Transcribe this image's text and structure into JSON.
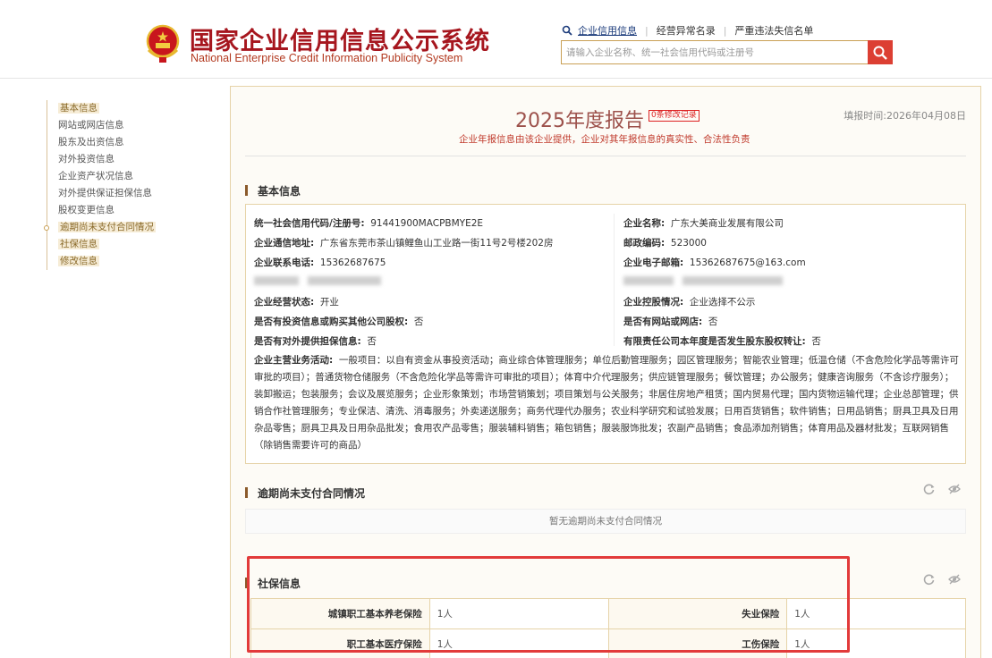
{
  "header": {
    "title_cn": "国家企业信用信息公示系统",
    "title_en": "National Enterprise Credit Information Publicity System",
    "nav": [
      "企业信用信息",
      "经营异常名录",
      "严重违法失信名单"
    ],
    "search_placeholder": "请输入企业名称、统一社会信用代码或注册号"
  },
  "sidenav": [
    {
      "label": "基本信息",
      "highlighted": true
    },
    {
      "label": "网站或网店信息",
      "highlighted": false
    },
    {
      "label": "股东及出资信息",
      "highlighted": false
    },
    {
      "label": "对外投资信息",
      "highlighted": false
    },
    {
      "label": "企业资产状况信息",
      "highlighted": false
    },
    {
      "label": "对外提供保证担保信息",
      "highlighted": false
    },
    {
      "label": "股权变更信息",
      "highlighted": false
    },
    {
      "label": "逾期尚未支付合同情况",
      "highlighted": true
    },
    {
      "label": "社保信息",
      "highlighted": true
    },
    {
      "label": "修改信息",
      "highlighted": true
    }
  ],
  "report": {
    "title": "2025年度报告",
    "badge": "0条修改记录",
    "fill_time": "填报时间:2026年04月08日",
    "notice": "企业年报信息由该企业提供，企业对其年报信息的真实性、合法性负责"
  },
  "basic": {
    "section_title": "基本信息",
    "credit_code_label": "统一社会信用代码/注册号:",
    "credit_code": "91441900MACPBMYE2E",
    "name_label": "企业名称:",
    "name": "广东大美商业发展有限公司",
    "address_label": "企业通信地址:",
    "address": "广东省东莞市茶山镇鲤鱼山工业路一街11号2号楼202房",
    "postcode_label": "邮政编码:",
    "postcode": "523000",
    "phone_label": "企业联系电话:",
    "phone": "15362687675",
    "email_label": "企业电子邮箱:",
    "email": "15362687675@163.com",
    "status_label": "企业经营状态:",
    "status": "开业",
    "holding_label": "企业控股情况:",
    "holding": "企业选择不公示",
    "invest_label": "是否有投资信息或购买其他公司股权:",
    "invest": "否",
    "website_label": "是否有网站或网店:",
    "website": "否",
    "guarantee_label": "是否有对外提供担保信息:",
    "guarantee": "否",
    "equity_transfer_label": "有限责任公司本年度是否发生股东股权转让:",
    "equity_transfer": "否",
    "scope_label": "企业主营业务活动:",
    "scope": "一般项目：以自有资金从事投资活动；商业综合体管理服务；单位后勤管理服务；园区管理服务；智能农业管理；低温仓储（不含危险化学品等需许可审批的项目）；普通货物仓储服务（不含危险化学品等需许可审批的项目）；体育中介代理服务；供应链管理服务；餐饮管理；办公服务；健康咨询服务（不含诊疗服务）；装卸搬运；包装服务；会议及展览服务；企业形象策划；市场营销策划；项目策划与公关服务；非居住房地产租赁；国内贸易代理；国内货物运输代理；企业总部管理；供销合作社管理服务；专业保洁、清洗、消毒服务；外卖递送服务；商务代理代办服务；农业科学研究和试验发展；日用百货销售；软件销售；日用品销售；厨具卫具及日用杂品零售；厨具卫具及日用杂品批发；食用农产品零售；服装辅料销售；箱包销售；服装服饰批发；农副产品销售；食品添加剂销售；体育用品及器材批发；互联网销售（除销售需要许可的商品）"
  },
  "overdue": {
    "section_title": "逾期尚未支付合同情况",
    "empty_text": "暂无逾期尚未支付合同情况"
  },
  "social_security": {
    "section_title": "社保信息",
    "rows": [
      {
        "l1": "城镇职工基本养老保险",
        "v1": "1人",
        "l2": "失业保险",
        "v2": "1人"
      },
      {
        "l1": "职工基本医疗保险",
        "v1": "1人",
        "l2": "工伤保险",
        "v2": "1人"
      }
    ]
  },
  "colors": {
    "brand_red": "#a6161e",
    "accent_gold": "#c9a055",
    "search_btn": "#dc3f33",
    "highlight_frame": "#e23a3a"
  }
}
